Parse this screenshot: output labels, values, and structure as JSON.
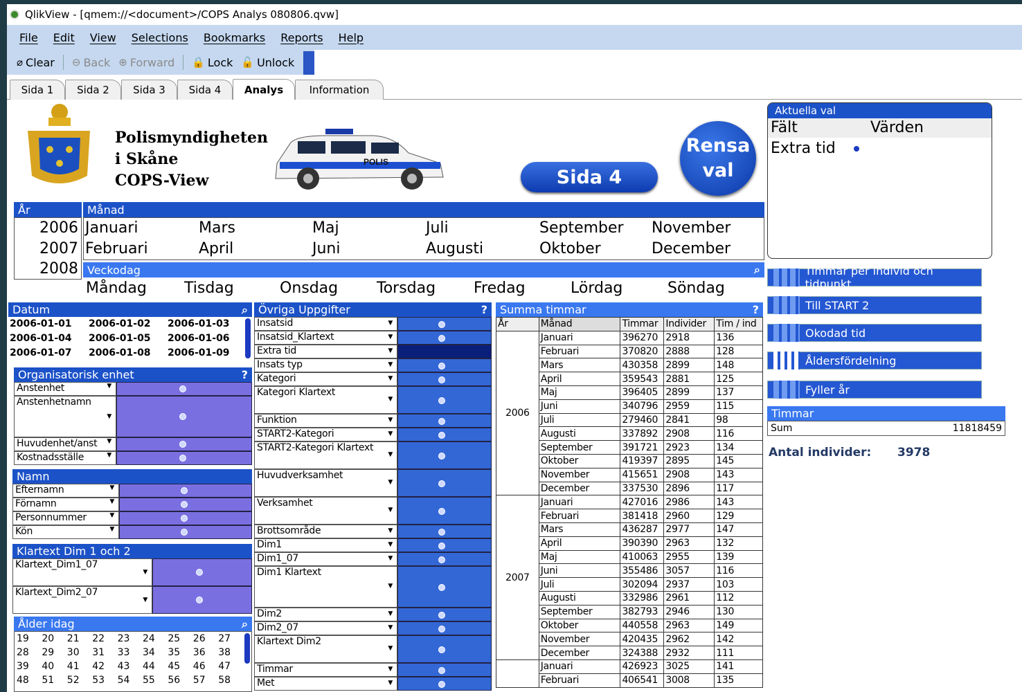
{
  "window": {
    "title": "QlikView - [qmem://<document>/COPS Analys 080806.qvw]"
  },
  "menu": [
    "File",
    "Edit",
    "View",
    "Selections",
    "Bookmarks",
    "Reports",
    "Help"
  ],
  "toolbar": {
    "clear": "Clear",
    "back": "Back",
    "forward": "Forward",
    "lock": "Lock",
    "unlock": "Unlock"
  },
  "tabs": [
    "Sida 1",
    "Sida 2",
    "Sida 3",
    "Sida 4",
    "Analys",
    "Information"
  ],
  "active_tab": "Analys",
  "logo_text": [
    "Polismyndigheten",
    "i Skåne",
    "COPS-View"
  ],
  "car_label": "POLIS",
  "buttons": {
    "sida4": "Sida 4",
    "rensa1": "Rensa",
    "rensa2": "val"
  },
  "current_selections": {
    "title": "Aktuella val",
    "col_field": "Fält",
    "col_values": "Värden",
    "field": "Extra tid"
  },
  "year": {
    "title": "År",
    "values": [
      "2006",
      "2007",
      "2008"
    ]
  },
  "month": {
    "title": "Månad",
    "rows": [
      [
        "Januari",
        "Mars",
        "Maj",
        "Juli",
        "September",
        "November"
      ],
      [
        "Februari",
        "April",
        "Juni",
        "Augusti",
        "Oktober",
        "December"
      ]
    ]
  },
  "weekday": {
    "title": "Veckodag",
    "values": [
      "Måndag",
      "Tisdag",
      "Onsdag",
      "Torsdag",
      "Fredag",
      "Lördag",
      "Söndag"
    ]
  },
  "datum": {
    "title": "Datum",
    "rows": [
      [
        "2006-01-01",
        "2006-01-02",
        "2006-01-03"
      ],
      [
        "2006-01-04",
        "2006-01-05",
        "2006-01-06"
      ],
      [
        "2006-01-07",
        "2006-01-08",
        "2006-01-09"
      ]
    ]
  },
  "org": {
    "title": "Organisatorisk enhet",
    "help": "?",
    "fields": [
      "Anstenhet",
      "Anstenhetnamn",
      "Huvudenhet/anst",
      "Kostnadsställe"
    ]
  },
  "namn": {
    "title": "Namn",
    "fields": [
      "Efternamn",
      "Förnamn",
      "Personnummer",
      "Kön"
    ]
  },
  "klartext": {
    "title": "Klartext Dim 1 och 2",
    "fields": [
      "Klartext_Dim1_07",
      "Klartext_Dim2_07"
    ]
  },
  "alder": {
    "title": "Ålder idag",
    "rows": [
      [
        "19",
        "20",
        "21",
        "22",
        "23",
        "24",
        "25",
        "26",
        "27"
      ],
      [
        "28",
        "29",
        "30",
        "31",
        "33",
        "34",
        "35",
        "36",
        "38"
      ],
      [
        "39",
        "40",
        "41",
        "42",
        "43",
        "44",
        "45",
        "46",
        "47"
      ],
      [
        "48",
        "51",
        "52",
        "53",
        "54",
        "55",
        "56",
        "57",
        "58"
      ]
    ]
  },
  "ovriga": {
    "title": "Övriga Uppgifter",
    "help": "?",
    "fields": [
      "Insatsid",
      "Insatsid_Klartext",
      "Extra tid",
      "Insats typ",
      "Kategori",
      "Kategori Klartext",
      "Funktion",
      "START2-Kategori",
      "START2-Kategori Klartext",
      "Huvudverksamhet",
      "Verksamhet",
      "Brottsområde",
      "Dim1",
      "Dim1_07",
      "Dim1 Klartext",
      "Dim2",
      "Dim2_07",
      "Klartext Dim2",
      "Timmar",
      "Met"
    ]
  },
  "summa": {
    "title": "Summa timmar",
    "help": "?",
    "headers": [
      "År",
      "Månad",
      "Timmar",
      "Individer",
      "Tim / ind"
    ],
    "groups": [
      {
        "year": "2006",
        "rows": [
          [
            "Januari",
            "396270",
            "2918",
            "136"
          ],
          [
            "Februari",
            "370820",
            "2888",
            "128"
          ],
          [
            "Mars",
            "430358",
            "2899",
            "148"
          ],
          [
            "April",
            "359543",
            "2881",
            "125"
          ],
          [
            "Maj",
            "396405",
            "2899",
            "137"
          ],
          [
            "Juni",
            "340796",
            "2959",
            "115"
          ],
          [
            "Juli",
            "279460",
            "2841",
            "98"
          ],
          [
            "Augusti",
            "337892",
            "2908",
            "116"
          ],
          [
            "September",
            "391721",
            "2923",
            "134"
          ],
          [
            "Oktober",
            "419397",
            "2895",
            "145"
          ],
          [
            "November",
            "415651",
            "2908",
            "143"
          ],
          [
            "December",
            "337530",
            "2896",
            "117"
          ]
        ]
      },
      {
        "year": "2007",
        "rows": [
          [
            "Januari",
            "427016",
            "2986",
            "143"
          ],
          [
            "Februari",
            "381418",
            "2960",
            "129"
          ],
          [
            "Mars",
            "436287",
            "2977",
            "147"
          ],
          [
            "April",
            "390390",
            "2963",
            "132"
          ],
          [
            "Maj",
            "410063",
            "2955",
            "139"
          ],
          [
            "Juni",
            "355486",
            "3057",
            "116"
          ],
          [
            "Juli",
            "302094",
            "2937",
            "103"
          ],
          [
            "Augusti",
            "332986",
            "2961",
            "112"
          ],
          [
            "September",
            "382793",
            "2946",
            "130"
          ],
          [
            "Oktober",
            "440558",
            "2963",
            "149"
          ],
          [
            "November",
            "420435",
            "2962",
            "142"
          ],
          [
            "December",
            "324388",
            "2932",
            "111"
          ]
        ]
      },
      {
        "year": "",
        "rows": [
          [
            "Januari",
            "426923",
            "3025",
            "141"
          ],
          [
            "Februari",
            "406541",
            "3008",
            "135"
          ]
        ]
      }
    ]
  },
  "side_buttons": [
    "Timmar per individ och tidpunkt",
    "Till START 2",
    "Okodad tid",
    "Åldersfördelning",
    "Fyller år"
  ],
  "timmar": {
    "title": "Timmar",
    "label": "Sum",
    "value": "11818459"
  },
  "antal": {
    "label": "Antal individer:",
    "value": "3978"
  }
}
